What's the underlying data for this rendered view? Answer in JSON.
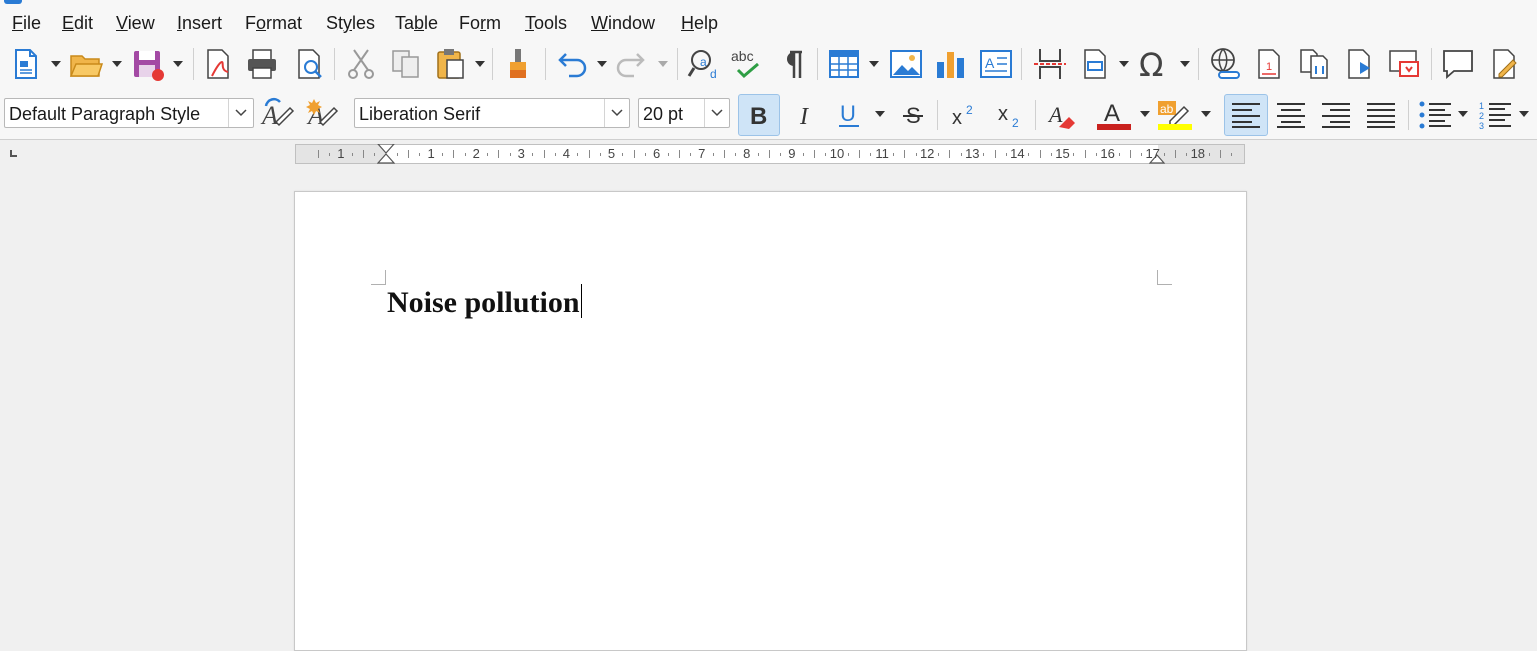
{
  "menu": [
    "File",
    "Edit",
    "View",
    "Insert",
    "Format",
    "Styles",
    "Table",
    "Form",
    "Tools",
    "Window",
    "Help"
  ],
  "menu_mnemonics": [
    "F",
    "E",
    "V",
    "I",
    "o",
    "y",
    "b",
    "r",
    "T",
    "W",
    "H"
  ],
  "toolbar": {
    "paragraph_style": "Default Paragraph Style",
    "font_name": "Liberation Serif",
    "font_size": "20 pt"
  },
  "document": {
    "heading": "Noise pollution"
  },
  "ruler": {
    "numbers": [
      "1",
      "1",
      "2",
      "3",
      "4",
      "5",
      "6",
      "7",
      "8",
      "9",
      "10",
      "11",
      "12",
      "13",
      "14",
      "15",
      "16",
      "17",
      "18"
    ]
  },
  "colors": {
    "accent": "#2a7bd4",
    "font_color": "#c9211e",
    "highlight": "#ffff00",
    "active_button": "#cfe4f7"
  },
  "icons": [
    "new-document-icon",
    "open-folder-icon",
    "save-icon",
    "export-pdf-icon",
    "print-icon",
    "print-preview-icon",
    "cut-icon",
    "copy-icon",
    "paste-icon",
    "clone-formatting-icon",
    "undo-icon",
    "redo-icon",
    "find-replace-icon",
    "spelling-icon",
    "formatting-marks-icon",
    "insert-table-icon",
    "insert-image-icon",
    "insert-chart-icon",
    "insert-textbox-icon",
    "page-break-icon",
    "insert-field-icon",
    "special-character-icon",
    "hyperlink-icon",
    "footnote-icon",
    "cross-reference-icon",
    "bookmark-icon",
    "comment-icon",
    "track-changes-icon"
  ]
}
